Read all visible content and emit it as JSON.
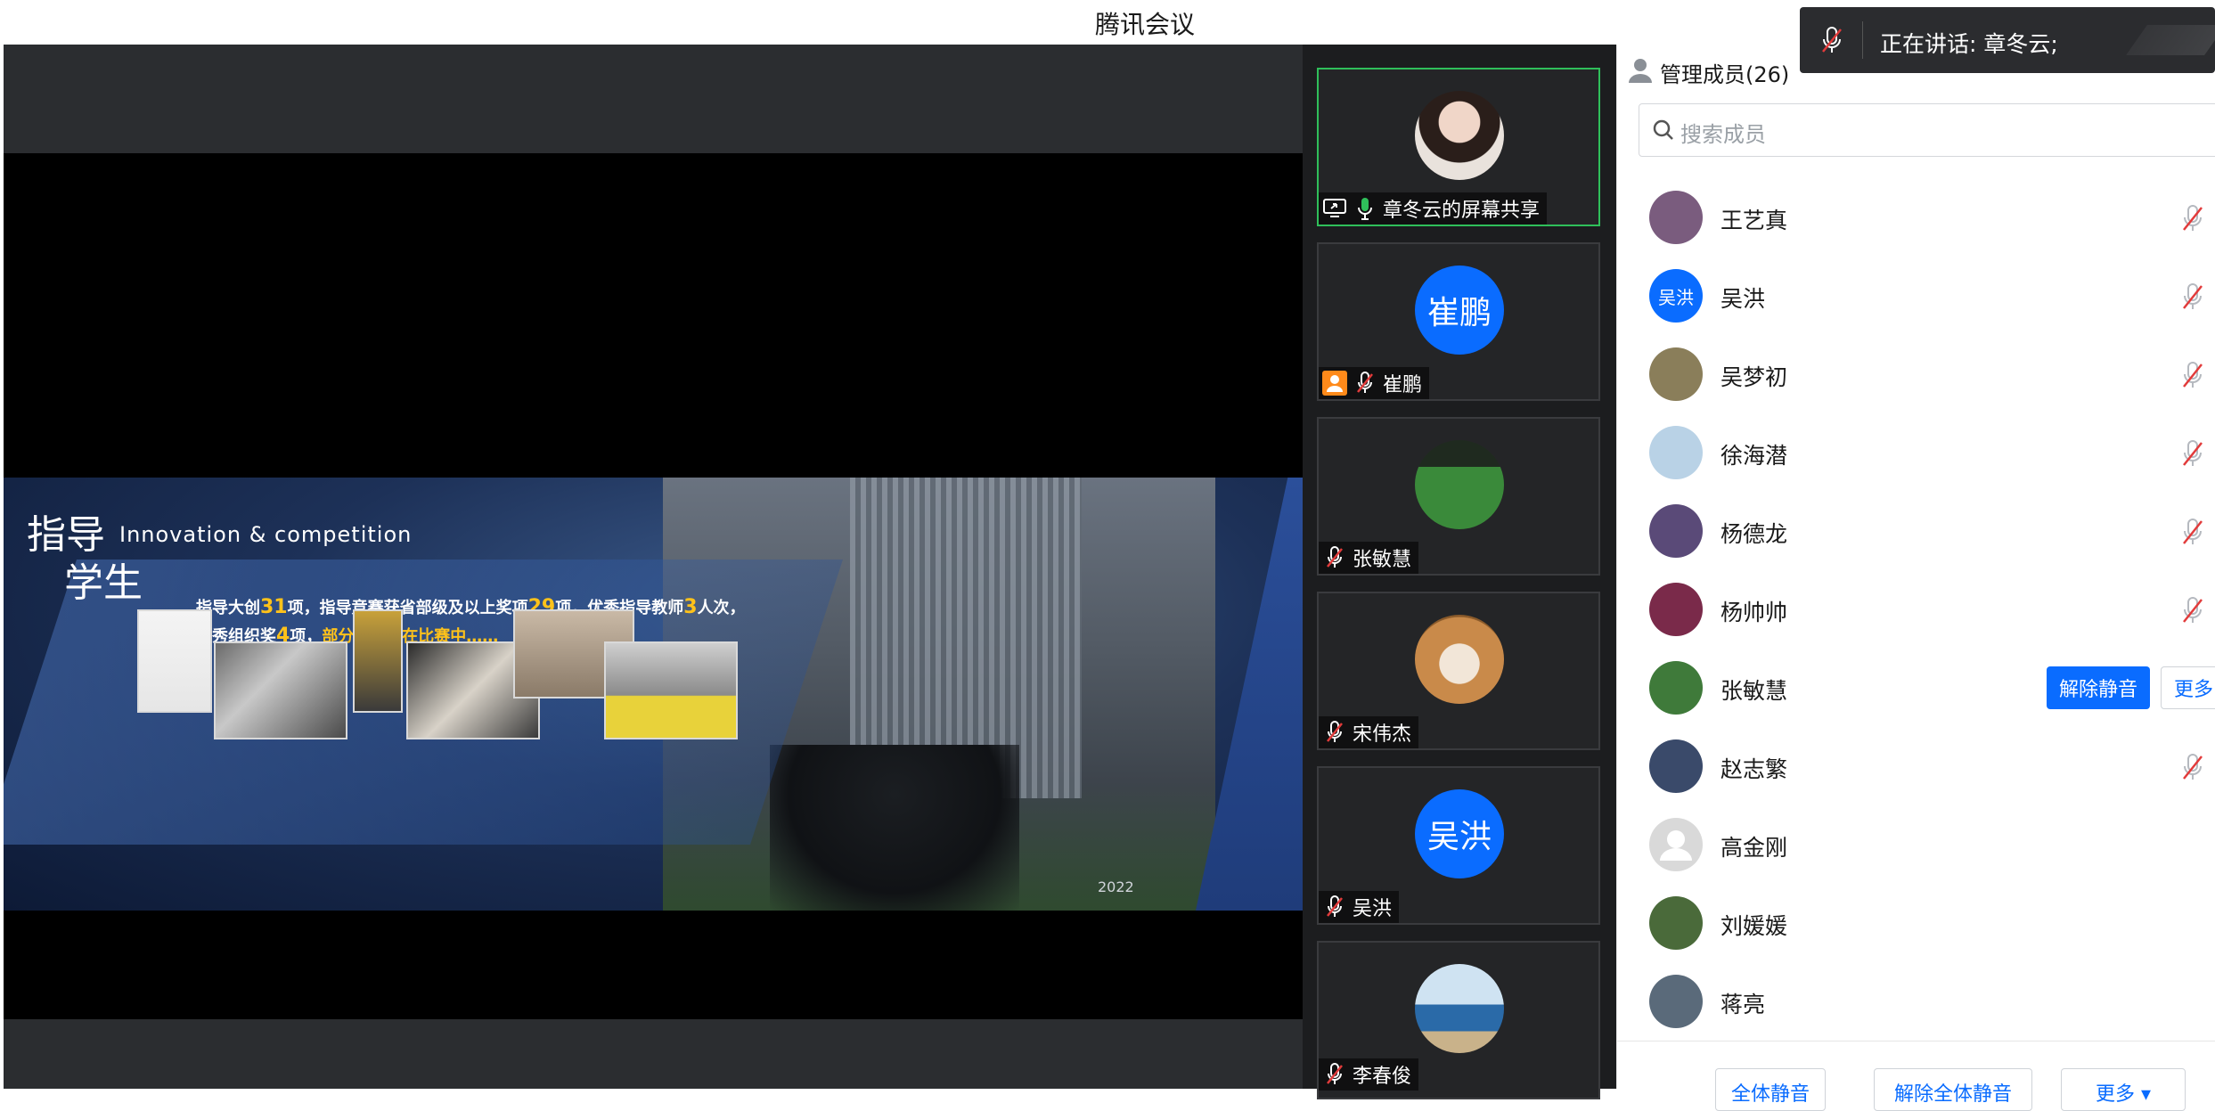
{
  "window": {
    "title": "腾讯会议"
  },
  "speaking_toast": {
    "text": "正在讲话: 章冬云;"
  },
  "slide": {
    "heading_line1": "指导",
    "heading_line2": "学生",
    "subtitle": "Innovation & competition",
    "line1_a": "指导大创",
    "line1_n1": "31",
    "line1_b": "项，指导竞赛获省部级及以上奖项",
    "line1_n2": "29",
    "line1_c": "项，优秀指导教师",
    "line1_n3": "3",
    "line1_d": "人次，",
    "line2_a": "优秀组织奖",
    "line2_n1": "4",
    "line2_b": "项，",
    "line2_hl": "部分项目尚在比赛中……",
    "year": "2022"
  },
  "video_tiles": [
    {
      "name": "章冬云的屏幕共享",
      "avatar_text": "",
      "active": true
    },
    {
      "name": "崔鹏",
      "avatar_text": "崔鹏"
    },
    {
      "name": "张敏慧",
      "avatar_text": ""
    },
    {
      "name": "宋伟杰",
      "avatar_text": ""
    },
    {
      "name": "吴洪",
      "avatar_text": "吴洪"
    },
    {
      "name": "李春俊",
      "avatar_text": ""
    }
  ],
  "members_panel": {
    "title": "管理成员(26)",
    "search_placeholder": "搜索成员",
    "members": [
      {
        "name": "王艺真",
        "avatar_text": "",
        "avatar_color": "#7a5c7e",
        "muted": true
      },
      {
        "name": "吴洪",
        "avatar_text": "吴洪",
        "avatar_color": "#0a6cff",
        "muted": true
      },
      {
        "name": "吴梦初",
        "avatar_text": "",
        "avatar_color": "#8a7e5a",
        "muted": true
      },
      {
        "name": "徐海潜",
        "avatar_text": "",
        "avatar_color": "#b9d2e6",
        "muted": true
      },
      {
        "name": "杨德龙",
        "avatar_text": "",
        "avatar_color": "#5a4a78",
        "muted": true
      },
      {
        "name": "杨帅帅",
        "avatar_text": "",
        "avatar_color": "#7a2a4a",
        "muted": true
      },
      {
        "name": "张敏慧",
        "avatar_text": "",
        "avatar_color": "#3f7a3a",
        "muted": false
      },
      {
        "name": "赵志繁",
        "avatar_text": "",
        "avatar_color": "#3a4a6a",
        "muted": true
      },
      {
        "name": "高金刚",
        "avatar_text": "",
        "avatar_color": "#d9d9d9",
        "muted": false
      },
      {
        "name": "刘媛媛",
        "avatar_text": "",
        "avatar_color": "#4a6a3a",
        "muted": false
      },
      {
        "name": "蒋亮",
        "avatar_text": "",
        "avatar_color": "#5a6a7a",
        "muted": false
      }
    ],
    "unmute_label": "解除静音",
    "more_label": "更多",
    "footer": {
      "mute_all": "全体静音",
      "unmute_all": "解除全体静音",
      "more": "更多 ▾"
    }
  },
  "colors": {
    "accent": "#0a6cff",
    "active_border": "#2fbf5a",
    "muted_red": "#e23b3b"
  }
}
